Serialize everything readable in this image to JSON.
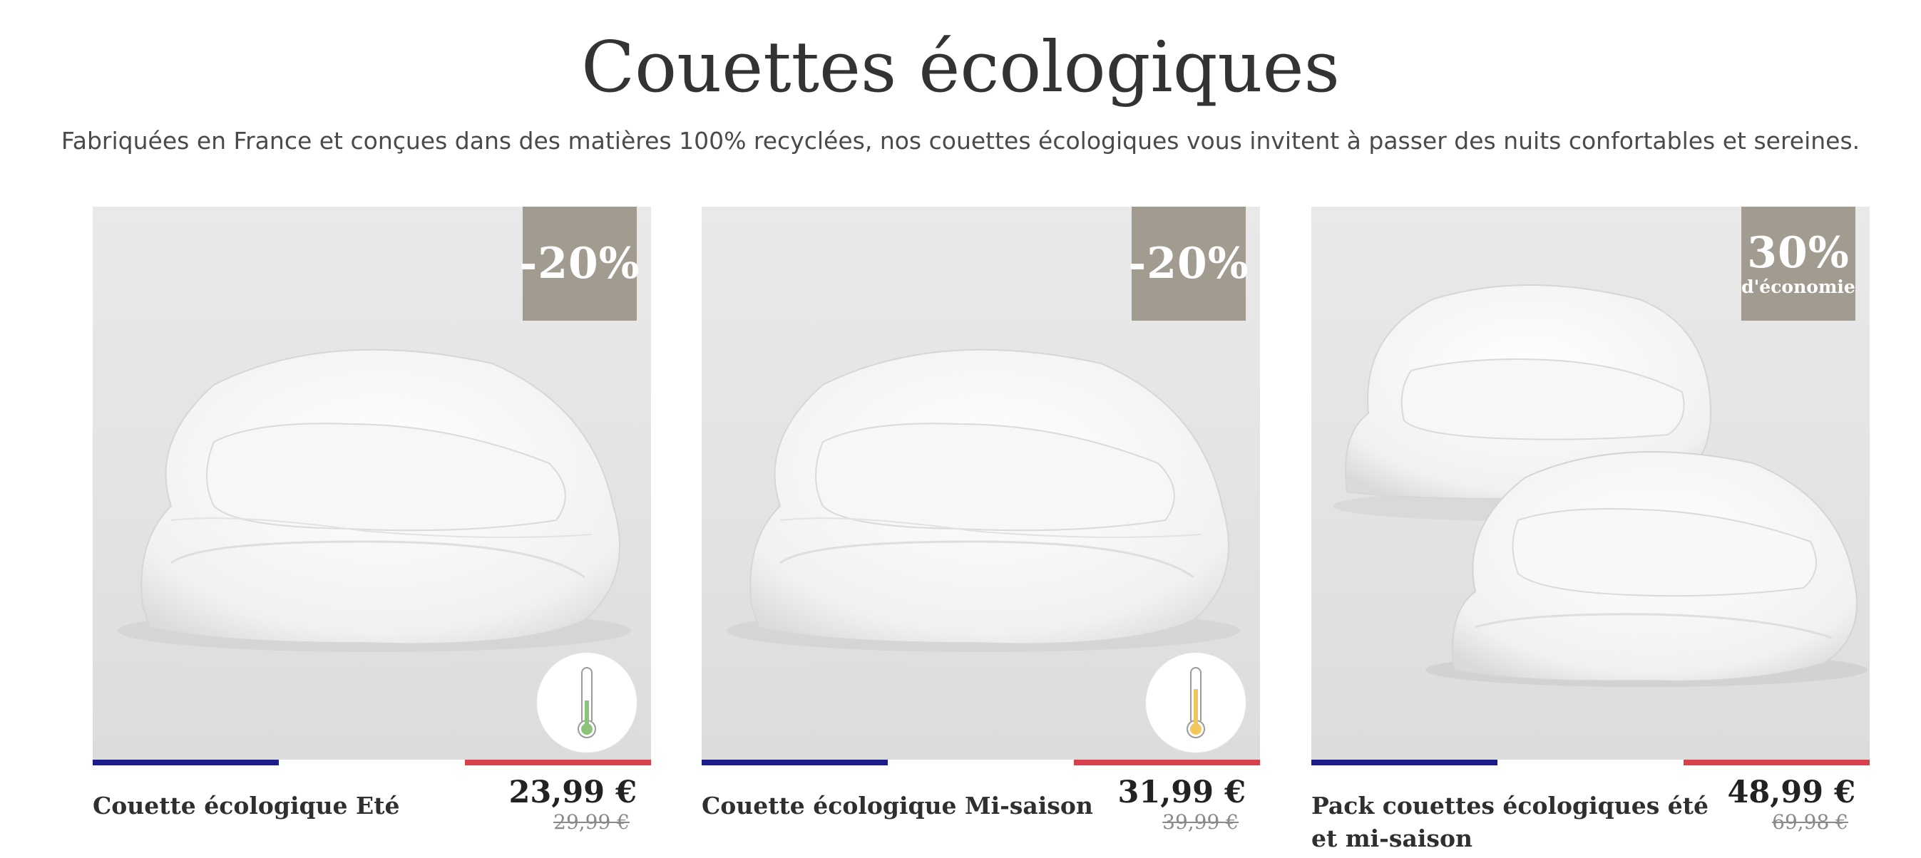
{
  "heading": "Couettes écologiques",
  "subheading": "Fabriquées en France et conçues dans des matières 100% recyclées, nos couettes écologiques vous invitent à passer des nuits confortables et sereines.",
  "colors": {
    "badge": "#a29b90",
    "flag_blue": "#1a1d8a",
    "flag_red": "#d9414a",
    "thermo_green": "#8bc37a",
    "thermo_yellow": "#f1c75b"
  },
  "products": [
    {
      "name": "Couette écologique Eté",
      "price": "23,99 €",
      "old_price": "29,99 €",
      "badge": {
        "pct": "-20%",
        "sub": ""
      },
      "thermometer": "thermometer-low-icon",
      "image": "folded-duvet"
    },
    {
      "name": "Couette écologique Mi-saison",
      "price": "31,99 €",
      "old_price": "39,99 €",
      "badge": {
        "pct": "-20%",
        "sub": ""
      },
      "thermometer": "thermometer-mid-icon",
      "image": "folded-duvet"
    },
    {
      "name": "Pack couettes écologiques été et mi-saison",
      "price": "48,99 €",
      "old_price": "69,98 €",
      "badge": {
        "pct": "30%",
        "sub": "d'économie"
      },
      "thermometer": "",
      "image": "two-folded-duvets"
    }
  ]
}
